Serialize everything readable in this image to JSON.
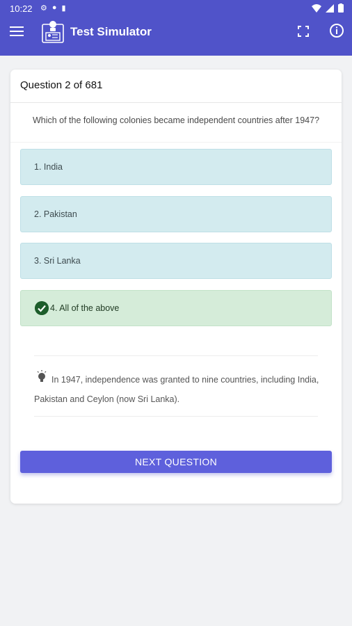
{
  "status_bar": {
    "time": "10:22"
  },
  "app_bar": {
    "title": "Test Simulator"
  },
  "question": {
    "counter": "Question 2 of 681",
    "text": "Which of the following colonies became independent countries after 1947?"
  },
  "options": [
    {
      "label": "1. India",
      "correct": false
    },
    {
      "label": "2. Pakistan",
      "correct": false
    },
    {
      "label": "3. Sri Lanka",
      "correct": false
    },
    {
      "label": "4. All of the above",
      "correct": true
    }
  ],
  "explanation": {
    "text": "In 1947, independence was granted to nine countries, including India, Pakistan and Ceylon (now Sri Lanka)."
  },
  "next_button": {
    "label": "NEXT QUESTION"
  },
  "colors": {
    "app_bar": "#5053c9",
    "option_bg": "#d3ebef",
    "correct_bg": "#d5ecd9",
    "check": "#1d5d2b",
    "button": "#5e60dc"
  },
  "icons": [
    "menu-icon",
    "app-logo-icon",
    "fullscreen-icon",
    "info-icon",
    "check-circle-icon",
    "lightbulb-icon"
  ]
}
